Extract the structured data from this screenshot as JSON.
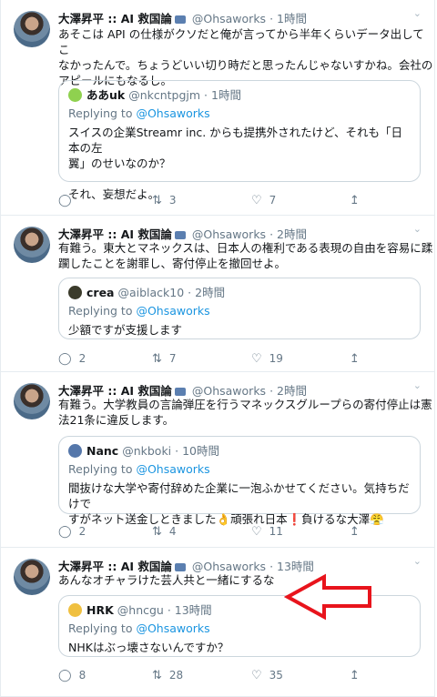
{
  "tweets": [
    {
      "name": "大澤昇平 :: AI 救国論",
      "handle": "@Ohsaworks",
      "time": "· 1時間",
      "text_lines": [
        "あそこは API の仕様がクソだと俺が言ってから半年くらいデータ出してこ",
        "なかったんで。ちょうどいい切り時だと思ったんじゃないすかね。会社の",
        "アピールにもなるし。"
      ],
      "quote": {
        "name": "ああuk",
        "handle": "@nkcntpgjm · 1時間",
        "replying_prefix": "Replying to ",
        "replying_to": "@Ohsaworks",
        "text_lines": [
          "スイスの企業Streamr inc. からも提携外されたけど、それも「日本の左",
          "翼」のせいなのか？",
          "",
          "それ、妄想だよ。"
        ],
        "avatar_color": "#8fd14f"
      },
      "reply": "",
      "retweet": "3",
      "like": "7"
    },
    {
      "name": "大澤昇平 :: AI 救国論",
      "handle": "@Ohsaworks",
      "time": "· 2時間",
      "text_lines": [
        "有難う。東大とマネックスは、日本人の権利である表現の自由を容易に蹂",
        "躙したことを謝罪し、寄付停止を撤回せよ。"
      ],
      "quote": {
        "name": "crea",
        "handle": "@aiblack10 · 2時間",
        "replying_prefix": "Replying to ",
        "replying_to": "@Ohsaworks",
        "text_lines": [
          "少額ですが支援します"
        ],
        "avatar_color": "#3b3b2b"
      },
      "reply": "2",
      "retweet": "7",
      "like": "19"
    },
    {
      "name": "大澤昇平 :: AI 救国論",
      "handle": "@Ohsaworks",
      "time": "· 2時間",
      "text_lines": [
        "有難う。大学教員の言論弾圧を行うマネックスグループらの寄付停止は憲",
        "法21条に違反します。"
      ],
      "quote": {
        "name": "Nanc",
        "handle": "@nkboki · 10時間",
        "replying_prefix": "Replying to ",
        "replying_to": "@Ohsaworks",
        "text_lines": [
          "間抜けな大学や寄付辞めた企業に一泡ふかせてください。気持ちだけで",
          "すがネット送金しときました👌頑張れ日本❗負けるな大澤😤"
        ],
        "avatar_color": "#5577aa"
      },
      "reply": "2",
      "retweet": "4",
      "like": "11"
    },
    {
      "name": "大澤昇平 :: AI 救国論",
      "handle": "@Ohsaworks",
      "time": "· 13時間",
      "text_lines": [
        "あんなオチャラけた芸人共と一緒にするな"
      ],
      "quote": {
        "name": "HRK",
        "handle": "@hncgu · 13時間",
        "replying_prefix": "Replying to ",
        "replying_to": "@Ohsaworks",
        "text_lines": [
          "NHKはぶっ壊さないんですか？"
        ],
        "avatar_color": "#f0c040"
      },
      "reply": "8",
      "retweet": "28",
      "like": "35"
    }
  ],
  "icons": {
    "reply": "reply-icon",
    "retweet": "retweet-icon",
    "like": "heart-icon",
    "share": "share-icon",
    "more": "chevron-down-icon"
  },
  "colors": {
    "link": "#1b95e0",
    "muted": "#657786",
    "arrow": "#e8141c"
  }
}
